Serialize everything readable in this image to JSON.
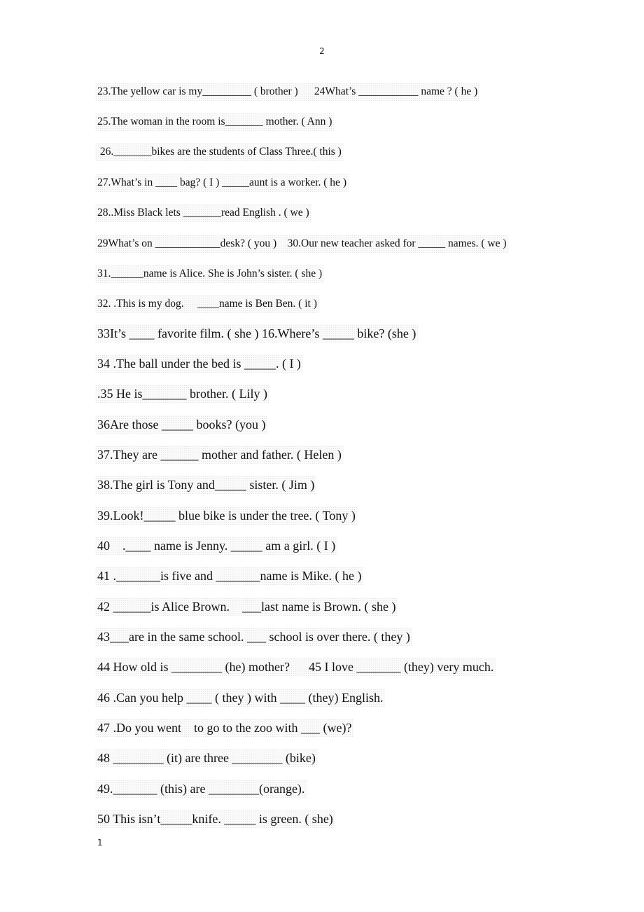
{
  "page": {
    "top_number": "2",
    "bottom_number": "1"
  },
  "lines": [
    "23.The yellow car is my_________ ( brother )      24What’s ___________ name ? ( he )",
    "25.The woman in the room is_______ mother. ( Ann )",
    " 26._______bikes are the students of Class Three.( this )",
    "27.What’s in ____ bag? ( I ) _____aunt is a worker. ( he )",
    "28..Miss Black lets _______read English . ( we )",
    "29What’s on ____________desk? ( you )    30.Our new teacher asked for _____ names. ( we )",
    "31.______name is Alice. She is John’s sister. ( she )",
    "32. .This is my dog.     ____name is Ben Ben. ( it )",
    "33It’s ____ favorite film. ( she ) 16.Where’s _____ bike? (she )",
    "34 .The ball under the bed is _____. ( I )",
    ".35 He is_______ brother. ( Lily )",
    "36Are those _____ books? (you )",
    "37.They are ______ mother and father. ( Helen )",
    "38.The girl is Tony and_____ sister. ( Jim )",
    "39.Look!_____ blue bike is under the tree. ( Tony )",
    "40    .____ name is Jenny. _____ am a girl. ( I )",
    "41 ._______is five and _______name is Mike. ( he )",
    "42 ______is Alice Brown.    ___last name is Brown. ( she )",
    "43___are in the same school. ___ school is over there. ( they )",
    "44 How old is ________ (he) mother?      45 I love _______ (they) very much.",
    "46 .Can you help ____ ( they ) with ____ (they) English.",
    "47 .Do you went    to go to the zoo with ___ (we)?",
    "48 ________ (it) are three ________ (bike)",
    "49._______ (this) are ________(orange).",
    "50 This isn’t_____knife. _____ is green. ( she)"
  ]
}
